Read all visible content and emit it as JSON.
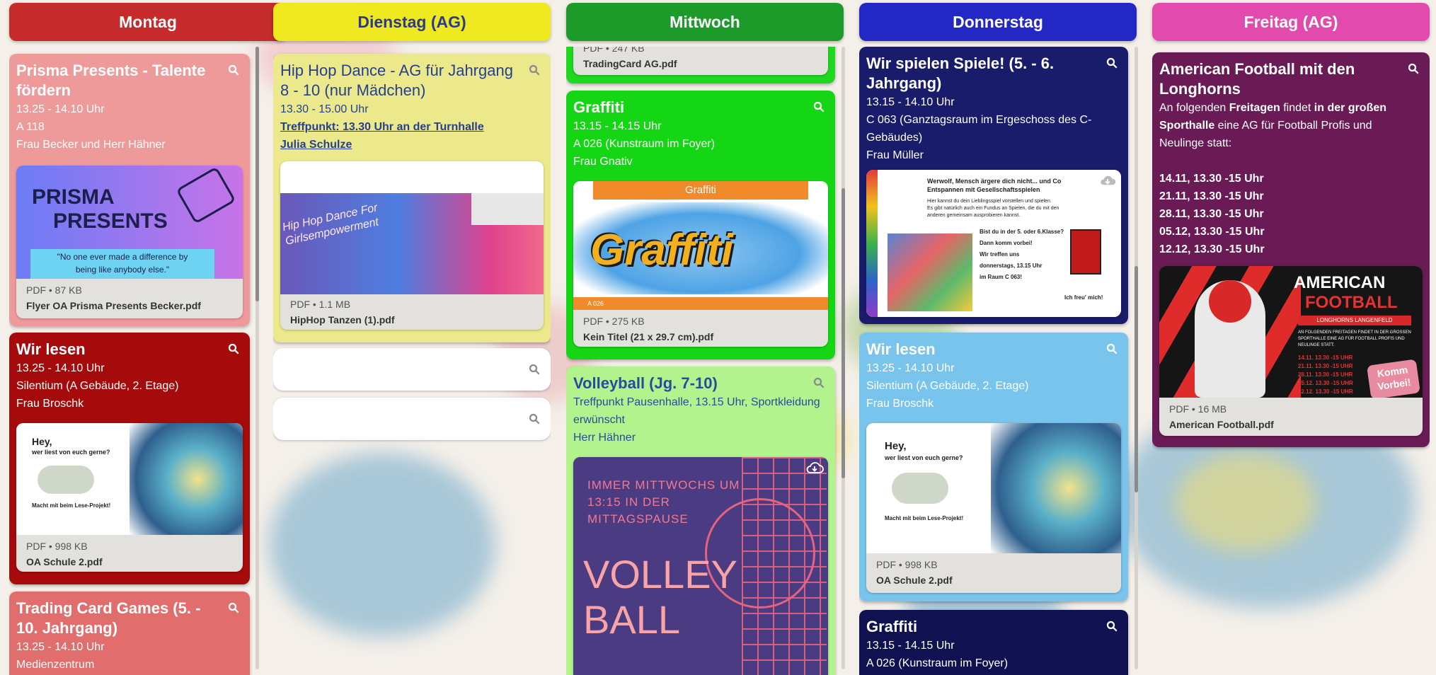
{
  "columns": [
    {
      "header": "Montag",
      "cards": [
        {
          "title": "Prisma Presents - Talente fördern",
          "lines": [
            "13.25 - 14.10 Uhr",
            "A 118",
            "Frau Becker und Herr Hähner"
          ],
          "attachment": {
            "meta": "PDF • 87 KB",
            "filename": "Flyer OA Prisma Presents Becker.pdf",
            "thumb_title_1": "PRISMA",
            "thumb_title_2": "PRESENTS",
            "thumb_quote_1": "\"No one ever made a difference by",
            "thumb_quote_2": "being like anybody else.\""
          }
        },
        {
          "title": "Wir lesen",
          "lines": [
            "13.25 - 14.10 Uhr",
            "Silentium (A Gebäude, 2. Etage)",
            "Frau Broschk"
          ],
          "attachment": {
            "meta": "PDF • 998 KB",
            "filename": "OA Schule 2.pdf",
            "thumb_text_1": "Hey,",
            "thumb_text_2": "wer liest von euch gerne?",
            "thumb_text_3": "Macht mit beim Lese-Projekt!"
          }
        },
        {
          "title": "Trading Card Games (5. - 10. Jahrgang)",
          "lines": [
            "13.25 - 14.10 Uhr",
            "Medienzentrum"
          ]
        }
      ]
    },
    {
      "header": "Dienstag (AG)",
      "cards": [
        {
          "title": "Hip Hop Dance - AG für Jahrgang 8 - 10 (nur Mädchen)",
          "lines": [
            "13.30 - 15.00 Uhr"
          ],
          "links": [
            "Treffpunkt: 13.30 Uhr an der Turnhalle",
            "Julia Schulze"
          ],
          "attachment": {
            "meta": "PDF • 1.1 MB",
            "filename": "HipHop Tanzen (1).pdf",
            "thumb_text_1": "Hip Hop Dance For",
            "thumb_text_2": "Girlsempowerment"
          }
        }
      ]
    },
    {
      "header": "Mittwoch",
      "cards": [
        {
          "attachment": {
            "meta": "PDF • 247 KB",
            "filename": "TradingCard AG.pdf"
          }
        },
        {
          "title": "Graffiti",
          "lines": [
            "13.15 - 14.15 Uhr",
            "A 026 (Kunstraum im Foyer)",
            "Frau Gnativ"
          ],
          "attachment": {
            "meta": "PDF • 275 KB",
            "filename": "Kein Titel (21 x 29.7 cm).pdf",
            "thumb_banner": "Graffiti",
            "thumb_word": "Graffiti",
            "thumb_room": "A 026"
          }
        },
        {
          "title": "Volleyball (Jg. 7-10)",
          "lines": [
            "Treffpunkt Pausenhalle, 13.15 Uhr, Sportkleidung erwünscht",
            "Herr Hähner"
          ],
          "attachment": {
            "thumb_line_1": "IMMER MITTWOCHS UM",
            "thumb_line_2": "13:15 IN DER",
            "thumb_line_3": "MITTAGSPAUSE",
            "thumb_big_1": "VOLLEY",
            "thumb_big_2": "BALL"
          }
        }
      ]
    },
    {
      "header": "Donnerstag",
      "cards": [
        {
          "title": "Wir spielen Spiele! (5. - 6. Jahrgang)",
          "lines": [
            "13.15 - 14.10 Uhr",
            "C 063 (Ganztagsraum im Ergeschoss des C-Gebäudes)",
            "Frau Müller"
          ],
          "attachment": {
            "thumb_head_1": "Werwolf, Mensch ärgere dich nicht... und Co",
            "thumb_head_2": "Entspannen mit Gesellschaftsspielen",
            "thumb_p1": "Hier kannst du dein Lieblingsspiel vorstellen und spielen.",
            "thumb_p2": "Es gibt natürlich auch ein Fundus an Spielen, die du mit den",
            "thumb_p3": "anderen gemeinsam ausprobieren kannst.",
            "thumb_q1": "Bist du in der 5. oder 6.Klasse?",
            "thumb_q2": "Dann komm vorbei!",
            "thumb_q3": "Wir treffen uns",
            "thumb_q4": "donnerstags, 13.15 Uhr",
            "thumb_q5": "im Raum C 063!",
            "thumb_sign": "Ich freu' mich!"
          }
        },
        {
          "title": "Wir lesen",
          "lines": [
            "13.25 - 14.10 Uhr",
            "Silentium (A Gebäude, 2. Etage)",
            "Frau Broschk"
          ],
          "attachment": {
            "meta": "PDF • 998 KB",
            "filename": "OA Schule 2.pdf",
            "thumb_text_1": "Hey,",
            "thumb_text_2": "wer liest von euch gerne?",
            "thumb_text_3": "Macht mit beim Lese-Projekt!"
          }
        },
        {
          "title": "Graffiti",
          "lines": [
            "13.15 - 14.15 Uhr",
            "A 026 (Kunstraum im Foyer)"
          ]
        }
      ]
    },
    {
      "header": "Freitag (AG)",
      "cards": [
        {
          "title": "American Football mit den Longhorns",
          "rich": {
            "p1a": "An folgenden ",
            "p1b": "Freitagen",
            "p1c": " findet ",
            "p1d": "in der großen Sporthalle",
            "p1e": " eine AG für Football Profis und Neulinge statt:"
          },
          "dates": [
            "14.11, 13.30 -15 Uhr",
            "21.11, 13.30 -15 Uhr",
            "28.11, 13.30 -15 Uhr",
            "05.12, 13.30 -15 Uhr",
            "12.12, 13.30 -15 Uhr"
          ],
          "attachment": {
            "meta": "PDF • 16 MB",
            "filename": "American Football.pdf",
            "thumb_t1": "AMERICAN",
            "thumb_t2": "FOOTBALL",
            "thumb_sub": "LONGHORNS LANGENFELD",
            "thumb_p1": "AN FOLGENDEN FREITAGEN FINDET IN DER GROSSEN",
            "thumb_p2": "SPORTHALLE EINE AG FÜR FOOTBALL PROFIS UND",
            "thumb_p3": "NEULINGE STATT:",
            "thumb_d1": "14.11. 13.30 -15 UHR",
            "thumb_d2": "21.11. 13.30 -15 UHR",
            "thumb_d3": "28.11. 13.30 -15 UHR",
            "thumb_d4": "05.12. 13.30 -15 UHR",
            "thumb_d5": "12.12. 13.30 -15 UHR",
            "thumb_stamp_1": "Komm",
            "thumb_stamp_2": "Vorbei!"
          }
        }
      ]
    }
  ],
  "icons": {
    "search": "search-icon",
    "cloud": "cloud-download-icon"
  },
  "colors": {
    "montag": "#c52b2b",
    "dienstag": "#eeea1f",
    "mittwoch": "#1c9a2a",
    "donnerstag": "#2327c4",
    "freitag": "#e24aae"
  }
}
